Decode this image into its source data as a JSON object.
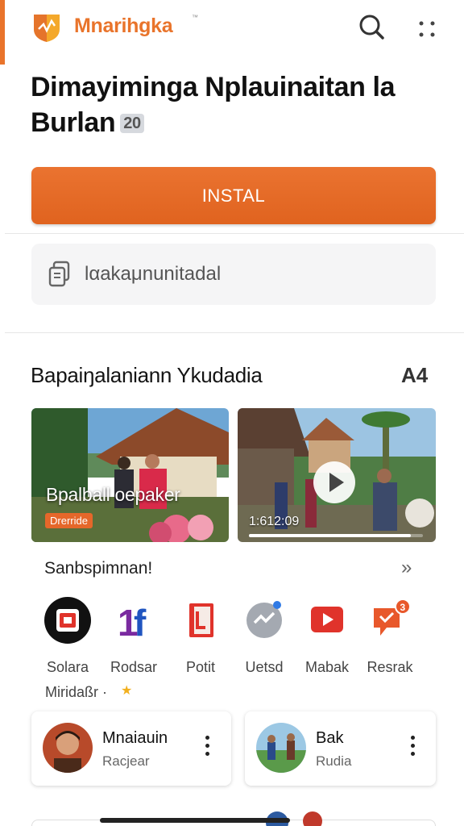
{
  "header": {
    "app_name": "Mnarihgka",
    "tm": "™",
    "logo_icon": "orange-shield-logo",
    "search_icon": "search-icon",
    "more_icon": "more-dots-icon"
  },
  "title": {
    "line1": "Dimayiminga Nplauinaitan la",
    "line2": "Burlan",
    "badge": "20"
  },
  "install": {
    "label": "INSTAL"
  },
  "info_field": {
    "text": "lαakaμnunitadal",
    "icon": "document-copy-icon"
  },
  "section": {
    "title": "Bapaiŋalaniann Ykudadia",
    "ad_label": "A4"
  },
  "cards": [
    {
      "caption": "Bpalball oepaker",
      "badge": "Drerride"
    },
    {
      "time": "1:612:09",
      "progress": 0.93
    }
  ],
  "apps_row": {
    "title": "Sanbspimnan!",
    "chevron": "»",
    "items": [
      {
        "label": "Solara",
        "icon": "red-square-tv-icon"
      },
      {
        "label": "Rodsar",
        "icon": "blue-1f-icon"
      },
      {
        "label": "Potit",
        "icon": "red-book-icon"
      },
      {
        "label": "Uetsd",
        "icon": "chat-bubble-icon"
      },
      {
        "label": "Mabak",
        "icon": "youtube-play-icon"
      },
      {
        "label": "Resrak",
        "icon": "notification-bubble-icon"
      }
    ]
  },
  "rating": {
    "text": "Miridaßr",
    "dot": "·",
    "star": "★"
  },
  "dev_cards": [
    {
      "name": "Mnaiauin",
      "sub": "Racjear"
    },
    {
      "name": "Bak",
      "sub": "Rudia"
    }
  ],
  "colors": {
    "accent": "#e9742b",
    "text": "#1a1a1a"
  }
}
